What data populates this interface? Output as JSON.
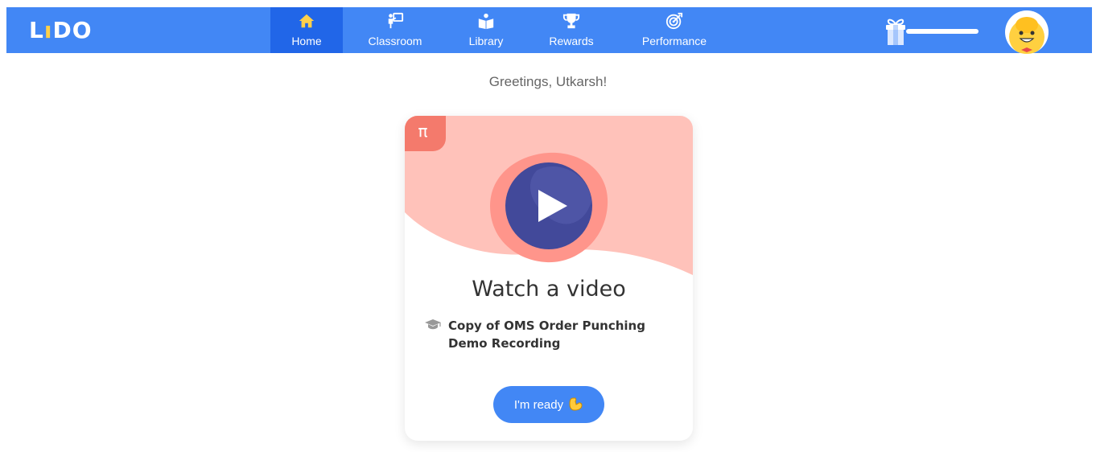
{
  "navbar": {
    "logo_text": "LIDO",
    "items": [
      {
        "label": "Home",
        "icon": "home-icon",
        "active": true
      },
      {
        "label": "Classroom",
        "icon": "classroom-icon",
        "active": false
      },
      {
        "label": "Library",
        "icon": "library-icon",
        "active": false
      },
      {
        "label": "Rewards",
        "icon": "trophy-icon",
        "active": false
      },
      {
        "label": "Performance",
        "icon": "target-icon",
        "active": false
      }
    ],
    "reward_icon": "gift-icon",
    "reward_progress": 1.0,
    "avatar_icon": "smiley-avatar-icon"
  },
  "greeting": "Greetings, Utkarsh!",
  "card": {
    "subject_symbol": "π",
    "title": "Watch a video",
    "lesson_icon": "graduation-cap-icon",
    "lesson_name": "Copy of OMS Order Punching Demo Recording",
    "button_label": "I'm ready",
    "button_icon": "flexed-biceps-icon"
  },
  "colors": {
    "nav_bg": "#4287f5",
    "nav_active": "#2166e8",
    "card_header": "#ffc2ba",
    "subject_badge": "#f47a6c",
    "play_outer": "#ff958b",
    "play_inner": "#42499a",
    "button": "#4287f5"
  }
}
